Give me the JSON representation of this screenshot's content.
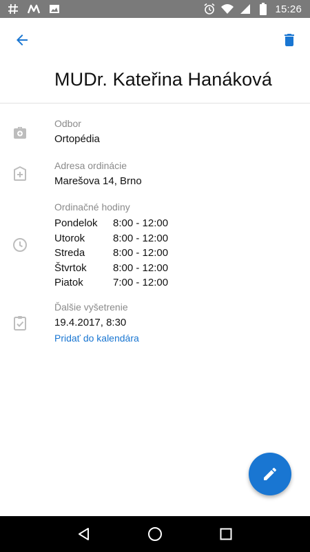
{
  "status_bar": {
    "time": "15:26",
    "left_icons": [
      "hashtag-icon",
      "m-app-icon",
      "image-icon"
    ],
    "right_icons": [
      "alarm-icon",
      "wifi-icon",
      "signal-icon",
      "battery-icon"
    ]
  },
  "header": {
    "title": "MUDr. Kateřina Hanáková",
    "back_icon": "arrow-left-icon",
    "delete_icon": "trash-icon"
  },
  "details": {
    "department": {
      "label": "Odbor",
      "value": "Ortopédia",
      "icon": "medical-bag-icon"
    },
    "address": {
      "label": "Adresa ordinácie",
      "value": "Marešova 14, Brno",
      "icon": "hospital-plus-icon"
    },
    "office_hours": {
      "label": "Ordinačné hodiny",
      "icon": "clock-icon",
      "rows": [
        {
          "day": "Pondelok",
          "hours": "8:00 - 12:00"
        },
        {
          "day": "Utorok",
          "hours": "8:00 - 12:00"
        },
        {
          "day": "Streda",
          "hours": "8:00 - 12:00"
        },
        {
          "day": "Štvrtok",
          "hours": "8:00 - 12:00"
        },
        {
          "day": "Piatok",
          "hours": "7:00 - 12:00"
        }
      ]
    },
    "next_exam": {
      "label": "Ďalšie vyšetrenie",
      "value": "19.4.2017, 8:30",
      "link": "Pridať do kalendára",
      "icon": "clipboard-check-icon"
    }
  },
  "fab": {
    "icon": "pencil-icon"
  },
  "colors": {
    "accent": "#1976d2",
    "status_bar": "#7a7a7a",
    "icon_gray": "#bdbdbd",
    "label_gray": "#8a8a8a"
  }
}
